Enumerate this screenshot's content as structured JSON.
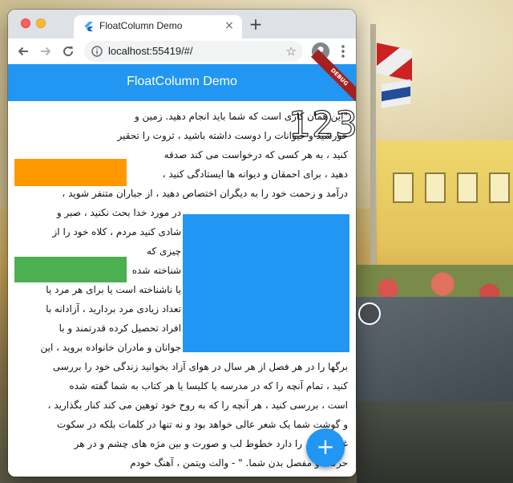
{
  "browser": {
    "tab_title": "FloatColumn Demo",
    "tab_close": "×",
    "new_tab": "+",
    "url": "localhost:55419/#/"
  },
  "app": {
    "title": "FloatColumn Demo",
    "debug_banner": "DEBUG",
    "float_text": "123",
    "fab_label": "+"
  },
  "colors": {
    "app_bar": "#2196f3",
    "orange_box": "#ff9800",
    "green_box": "#4caf50",
    "blue_box": "#2196f3"
  },
  "text_lines": [
    "\"این همان کاری است که شما باید انجام دهید. زمین و",
    "خورشید و حیوانات را دوست داشته باشید ، ثروت را تحقیر",
    "کنید ، به هر کسی که درخواست می کند صدقه",
    "دهید ، برای احمقان و دیوانه ها ایستادگی کنید ،",
    "درآمد و زحمت خود را به دیگران اختصاص دهید ، از جباران متنفر شوید ،",
    "در مورد خدا بحث نکنید ، صبر و",
    "شادی کنید مردم ، کلاه خود را از",
    "چیزی که",
    "شناخته شده",
    "یا ناشناخته است یا برای هر مرد یا",
    "تعداد زیادی مرد بردارید ، آزادانه با",
    "افراد تحصیل کرده قدرتمند و با",
    "جوانان و مادران خانواده بروید ، این",
    "برگها را در هر فصل از هر سال در هوای آزاد بخوانید زندگی خود را بررسی",
    "کنید ، تمام آنچه را که در مدرسه یا کلیسا یا هر کتاب به شما گفته شده",
    "است ، بررسی کنید ، هر آنچه را که به روح خود توهین می کند کنار بگذارید ،",
    "و گوشت شما یک شعر عالی خواهد بود و نه تنها در کلمات بلکه در سکوت",
    "غنی تسلط را دارد خطوط لب و صورت و بین مژه های چشم و در هر",
    "حرکت و مفصل بدن شما. \" - والت ویتمن ، آهنگ خودم"
  ]
}
